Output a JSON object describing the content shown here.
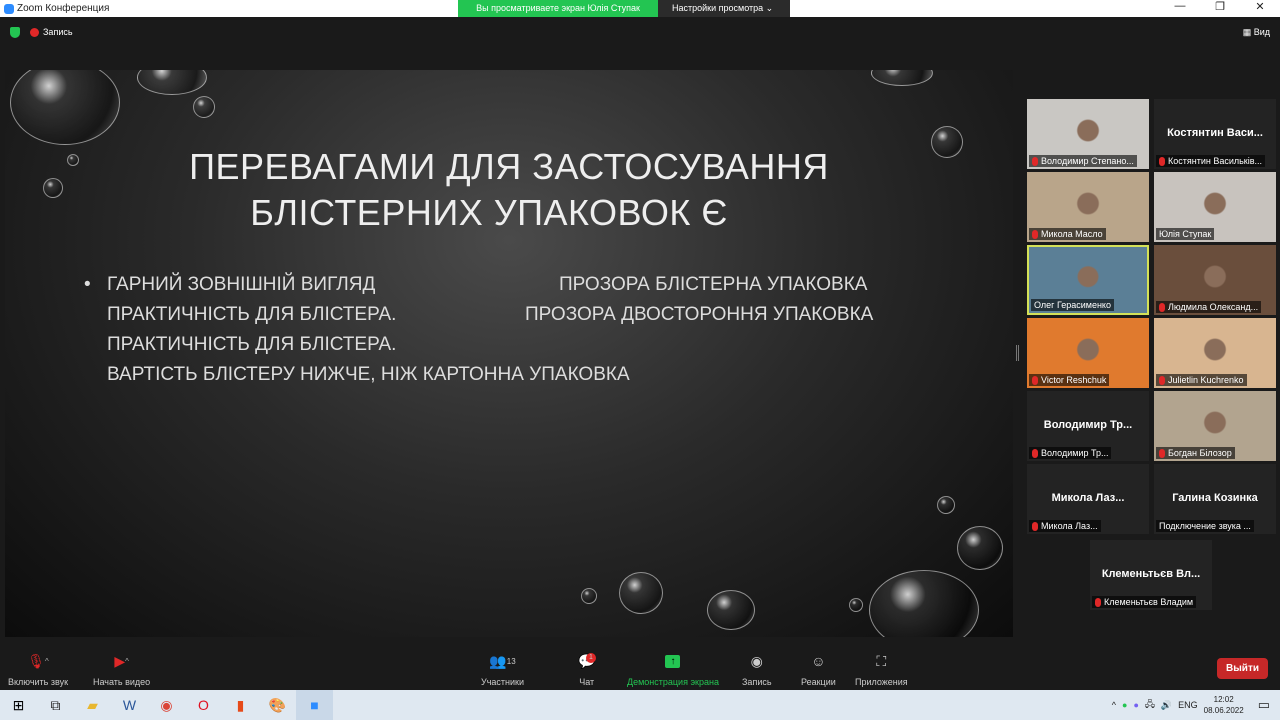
{
  "window": {
    "title": "Zoom Конференция",
    "min": "—",
    "max": "❐",
    "close": "✕"
  },
  "banner": {
    "viewing": "Вы просматриваете экран Юлія Ступак",
    "view_settings": "Настройки просмотра ⌄"
  },
  "topbar": {
    "record": "Запись",
    "view": "Вид"
  },
  "slide": {
    "title_line1": "ПЕРЕВАГАМИ ДЛЯ  ЗАСТОСУВАННЯ",
    "title_line2": "БЛІСТЕРНИХ УПАКОВОК Є",
    "left": [
      "ГАРНИЙ ЗОВНІШНІЙ ВИГЛЯД",
      "ПРАКТИЧНІСТЬ ДЛЯ БЛІСТЕРА.",
      "ПРАКТИЧНІСТЬ ДЛЯ БЛІСТЕРА.",
      "ВАРТІСТЬ БЛІСТЕРУ НИЖЧЕ, НІЖ КАРТОННА УПАКОВКА"
    ],
    "right": [
      "ПРОЗОРА БЛІСТЕРНА УПАКОВКА",
      "ПРОЗОРА ДВОСТОРОННЯ УПАКОВКА"
    ]
  },
  "participants": [
    {
      "name": "Володимир Степано...",
      "big": "",
      "video": true,
      "color": "#c9c7c3"
    },
    {
      "name": "Костянтин Васильків...",
      "big": "Костянтин Васи...",
      "video": false
    },
    {
      "name": "Микола Масло",
      "big": "",
      "video": true,
      "color": "#b9a58a"
    },
    {
      "name": "Юлія Ступак",
      "big": "",
      "video": true,
      "color": "#c8c3be"
    },
    {
      "name": "Олег Герасименко",
      "big": "",
      "video": true,
      "color": "#5b7f96"
    },
    {
      "name": "Людмила  Олександ...",
      "big": "",
      "video": true,
      "color": "#6a4e3c"
    },
    {
      "name": "Victor Reshchuk",
      "big": "",
      "video": true,
      "color": "#e07a2e"
    },
    {
      "name": "Julietlin Kuchrenko",
      "big": "",
      "video": true,
      "color": "#d8b590"
    },
    {
      "name": "Володимир Тр...",
      "big": "Володимир  Тр...",
      "video": false
    },
    {
      "name": "Богдан Білозор",
      "big": "",
      "video": true,
      "color": "#b2a48f"
    },
    {
      "name": "Микола Лаз...",
      "big": "Микола Лаз...",
      "video": false
    },
    {
      "name": "Подключение звука ...",
      "big": "Галина Козинка",
      "video": false
    },
    {
      "name": "Клеменьтьєв Владим",
      "big": "Клеменьтьєв Вл...",
      "video": false
    }
  ],
  "toolbar": {
    "unmute": "Включить звук",
    "start_video": "Начать видео",
    "participants": "Участники",
    "participants_count": "13",
    "chat": "Чат",
    "chat_badge": "1",
    "share": "Демонстрация экрана",
    "record": "Запись",
    "reactions": "Реакции",
    "apps": "Приложения",
    "leave": "Выйти"
  },
  "taskbar": {
    "lang": "ENG",
    "time": "12:02",
    "date": "08.06.2022"
  }
}
